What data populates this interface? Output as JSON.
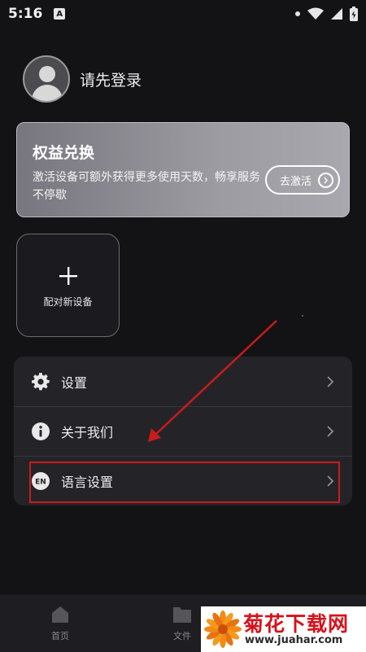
{
  "status_bar": {
    "time": "5:16",
    "notification_badge": "A"
  },
  "profile": {
    "login_prompt": "请先登录"
  },
  "benefit_card": {
    "title": "权益兑换",
    "description": "激活设备可额外获得更多使用天数，畅享服务不停歇",
    "button_label": "去激活"
  },
  "pair_device": {
    "label": "配对新设备"
  },
  "menu": {
    "items": [
      {
        "label": "设置",
        "icon": "gear-icon"
      },
      {
        "label": "关于我们",
        "icon": "info-icon"
      },
      {
        "label": "语言设置",
        "icon": "en-language-icon",
        "icon_text": "EN"
      }
    ]
  },
  "bottom_nav": {
    "items": [
      {
        "label": "首页",
        "icon": "home-icon"
      },
      {
        "label": "文件",
        "icon": "folder-icon"
      }
    ]
  },
  "watermark": {
    "title": "菊花下载网",
    "url": "www.juahar.com"
  },
  "colors": {
    "background": "#131316",
    "menu_background": "#242428",
    "highlight_red": "#c81c1c"
  }
}
